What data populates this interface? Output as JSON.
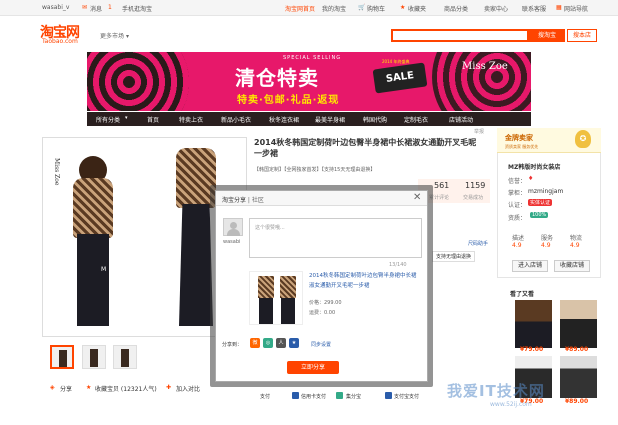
{
  "topbar": {
    "user": "wasabi_v",
    "msg": "消息",
    "msg_count": "1",
    "mobile": "手机逛淘宝",
    "home": "淘宝网首页",
    "mytaobao": "我的淘宝",
    "cart": "购物车",
    "fav": "收藏夹",
    "category": "商品分类",
    "seller": "卖家中心",
    "service": "联系客服",
    "sitemap": "网站导航"
  },
  "header": {
    "logo_cn": "淘宝网",
    "logo_en": "Taobao.com",
    "market": "更多市场",
    "search_all": "搜淘宝",
    "search_shop": "搜本店"
  },
  "banner": {
    "special": "SPECIAL SELLING",
    "title": "清仓特卖",
    "sub": "特卖·包邮·礼品·返现",
    "sale_top": "2014 年终盛典",
    "sale": "SALE",
    "brand": "Miss Zoe"
  },
  "nav": {
    "items": [
      "所有分类",
      "首页",
      "特卖上衣",
      "新品小毛衣",
      "秋冬连衣裙",
      "最美半身裙",
      "韩国代购",
      "定制毛衣",
      "店铺活动"
    ]
  },
  "product": {
    "title": "2014秋冬韩国定制荷叶边包臀半身裙中长裙淑女通勤开叉毛呢一步裙",
    "tags": "【韩国定制】【全网独家首发】【支持15天无理由退换】",
    "right_label": "举报",
    "stats": [
      {
        "num": "561",
        "label": "累计评论"
      },
      {
        "num": "1159",
        "label": "交易成功"
      }
    ],
    "size_help": "尺码助手",
    "return_label": "支持无理由退换"
  },
  "shop": {
    "level": "金牌卖家",
    "level_sub": "资质卖家 服务优先",
    "name": "MZ韩版时尚女装店",
    "credit_label": "信誉：",
    "seller_label": "掌柜：",
    "seller_name": "mzmingjam",
    "auth_label": "认证：",
    "auth_badge": "实体认证",
    "quality_label": "资质：",
    "quality_value": "100%",
    "ratings": [
      {
        "label": "描述",
        "value": "4.9"
      },
      {
        "label": "服务",
        "value": "4.9"
      },
      {
        "label": "物流",
        "value": "4.9"
      }
    ],
    "enter": "进入店铺",
    "collect": "收藏店铺",
    "see_title": "看了又看",
    "rec_prices": [
      "¥79.00",
      "¥89.00",
      "¥79.00",
      "¥89.00"
    ]
  },
  "gallery": {
    "watermark": "Miss Zoe"
  },
  "dialog": {
    "title": "淘宝分享",
    "title_sep": " | 社区",
    "close": "✕",
    "avatar_name": "wasabi",
    "placeholder": "这个很赞哦...",
    "counter": "13/140",
    "item_title": "2014秋冬韩国定制荷叶边包臀半身裙中长裙淑女通勤开叉毛呢一步裙",
    "price": "价格：299.00",
    "shipping": "运费：0.00",
    "share_to": "分享到：",
    "sync": "同步设置",
    "share_btn": "立即分享"
  },
  "bottom": {
    "share": "分享",
    "fav": "收藏宝贝 (12321人气)",
    "compare": "加入对比",
    "pay_items": [
      "支付",
      "信用卡支付",
      "集分宝",
      "支付宝支付"
    ]
  },
  "watermark": {
    "main": "我爱IT技术网",
    "url": "www.52ij.com"
  },
  "colors": {
    "brand": "#ff4400",
    "banner": "#e7186a",
    "nav": "#2a1f1f",
    "link": "#2a5caa"
  }
}
